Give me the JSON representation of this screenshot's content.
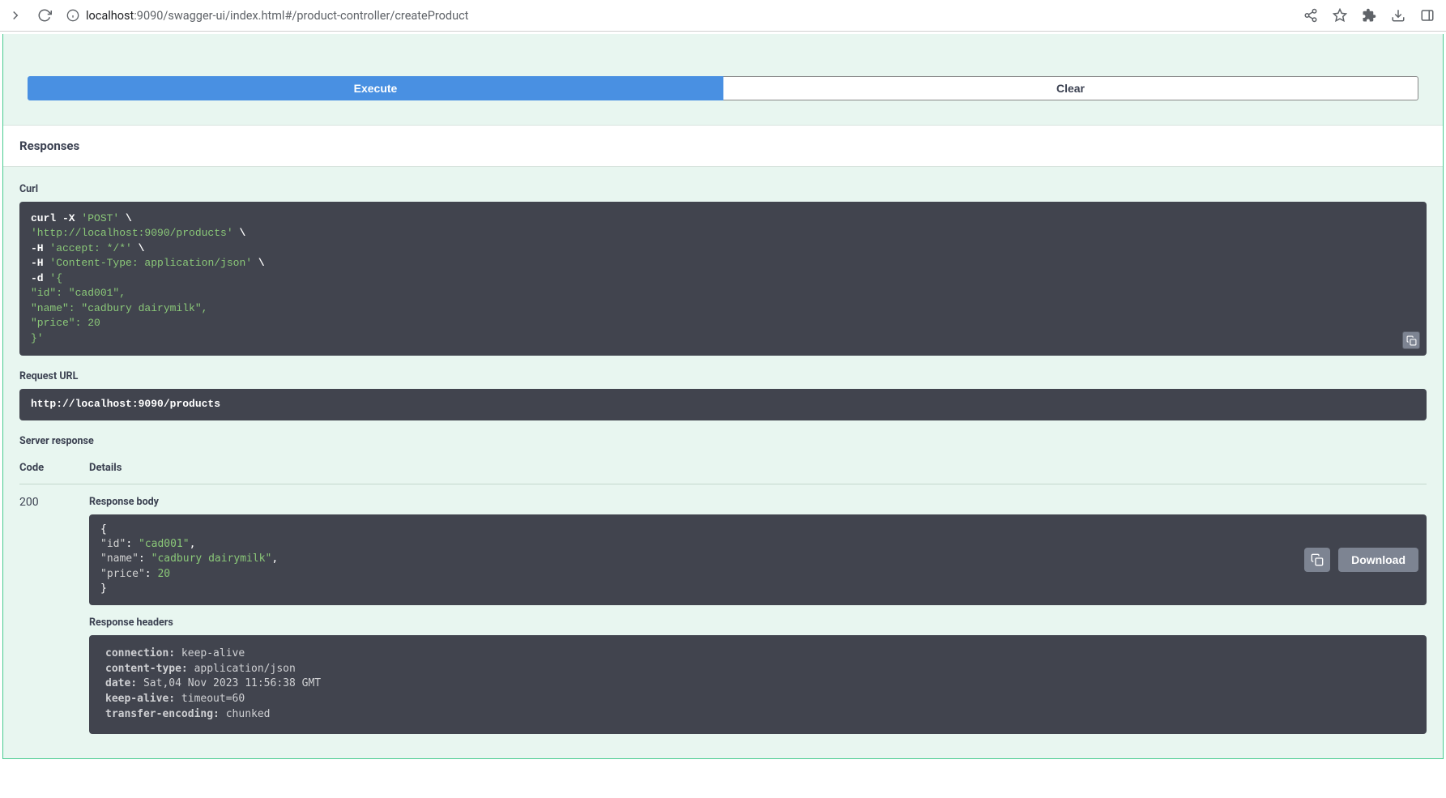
{
  "browser": {
    "url_host": "localhost",
    "url_rest": ":9090/swagger-ui/index.html#/product-controller/createProduct"
  },
  "buttons": {
    "execute": "Execute",
    "clear": "Clear",
    "download": "Download"
  },
  "labels": {
    "responses": "Responses",
    "curl": "Curl",
    "request_url": "Request URL",
    "server_response": "Server response",
    "code": "Code",
    "details": "Details",
    "response_body": "Response body",
    "response_headers": "Response headers"
  },
  "curl": {
    "l0a": "curl -X ",
    "l0b": "'POST'",
    "l0c": " \\",
    "l1a": "  ",
    "l1b": "'http://localhost:9090/products'",
    "l1c": " \\",
    "l2a": "  -H ",
    "l2b": "'accept: */*'",
    "l2c": " \\",
    "l3a": "  -H ",
    "l3b": "'Content-Type: application/json'",
    "l3c": " \\",
    "l4a": "  -d ",
    "l4b": "'{",
    "l5": "  \"id\": \"cad001\",",
    "l6": "  \"name\": \"cadbury dairymilk\",",
    "l7": "  \"price\": 20",
    "l8": "}'"
  },
  "request_url": "http://localhost:9090/products",
  "response": {
    "status": "200",
    "body": {
      "open": "{",
      "l1k": "  \"id\"",
      "l1c": ": ",
      "l1v": "\"cad001\"",
      "l1e": ",",
      "l2k": "  \"name\"",
      "l2c": ": ",
      "l2v": "\"cadbury dairymilk\"",
      "l2e": ",",
      "l3k": "  \"price\"",
      "l3c": ": ",
      "l3v": "20",
      "close": "}"
    },
    "headers": {
      "h0k": "connection: ",
      "h0v": "keep-alive",
      "h1k": "content-type: ",
      "h1v": "application/json",
      "h2k": "date: ",
      "h2v": "Sat,04 Nov 2023 11:56:38 GMT",
      "h3k": "keep-alive: ",
      "h3v": "timeout=60",
      "h4k": "transfer-encoding: ",
      "h4v": "chunked"
    }
  }
}
